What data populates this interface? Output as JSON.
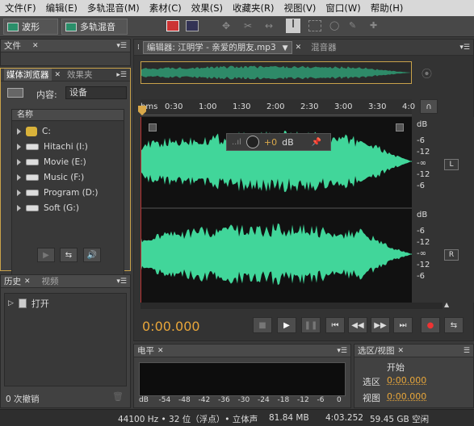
{
  "menu": [
    "文件(F)",
    "编辑(E)",
    "多轨混音(M)",
    "素材(C)",
    "效果(S)",
    "收藏夹(R)",
    "视图(V)",
    "窗口(W)",
    "帮助(H)"
  ],
  "toolbar": {
    "waveform": "波形",
    "multitrack": "多轨混音"
  },
  "files_panel": {
    "tab": "文件"
  },
  "browser": {
    "tab": "媒体浏览器",
    "tab2": "效果夹",
    "content_label": "内容:",
    "content_value": "设备",
    "col_header": "名称",
    "items": [
      {
        "label": "C:"
      },
      {
        "label": "Hitachi (I:)"
      },
      {
        "label": "Movie (E:)"
      },
      {
        "label": "Music (F:)"
      },
      {
        "label": "Program (D:)"
      },
      {
        "label": "Soft (G:)"
      }
    ]
  },
  "history": {
    "tab": "历史",
    "tab2": "视频",
    "item": "打开",
    "undo_count": "0 次撤销"
  },
  "editor": {
    "tab": "编辑器: 江明学 - 亲爱的朋友.mp3",
    "tab2": "混音器"
  },
  "ruler": {
    "unit": "hms",
    "ticks": [
      "0:30",
      "1:00",
      "1:30",
      "2:00",
      "2:30",
      "3:00",
      "3:30",
      "4:0"
    ]
  },
  "hud": {
    "gain": "+0",
    "unit": "dB"
  },
  "db_top": [
    "dB",
    "-6",
    "-12",
    "-∞",
    "-12",
    "-6"
  ],
  "db_bottom": [
    "dB",
    "-6",
    "-12",
    "-∞",
    "-12",
    "-6"
  ],
  "channels": {
    "left": "L",
    "right": "R"
  },
  "time": "0:00.000",
  "meter": {
    "tab": "电平",
    "scale": [
      "dB",
      "-54",
      "-48",
      "-42",
      "-36",
      "-30",
      "-24",
      "-18",
      "-12",
      "-6",
      "0"
    ]
  },
  "selection": {
    "tab": "选区/视图",
    "start": "开始",
    "sel_label": "选区",
    "view_label": "视图",
    "sel_val": "0:00.000",
    "view_val": "0:00.000"
  },
  "status": {
    "rate": "44100 Hz • 32 位（浮点）• 立体声",
    "size": "81.84 MB",
    "dur": "4:03.252",
    "free": "59.45 GB 空闲"
  },
  "colors": {
    "wave": "#41d69a",
    "time": "#e8a63a",
    "accent": "#d9a84a"
  }
}
